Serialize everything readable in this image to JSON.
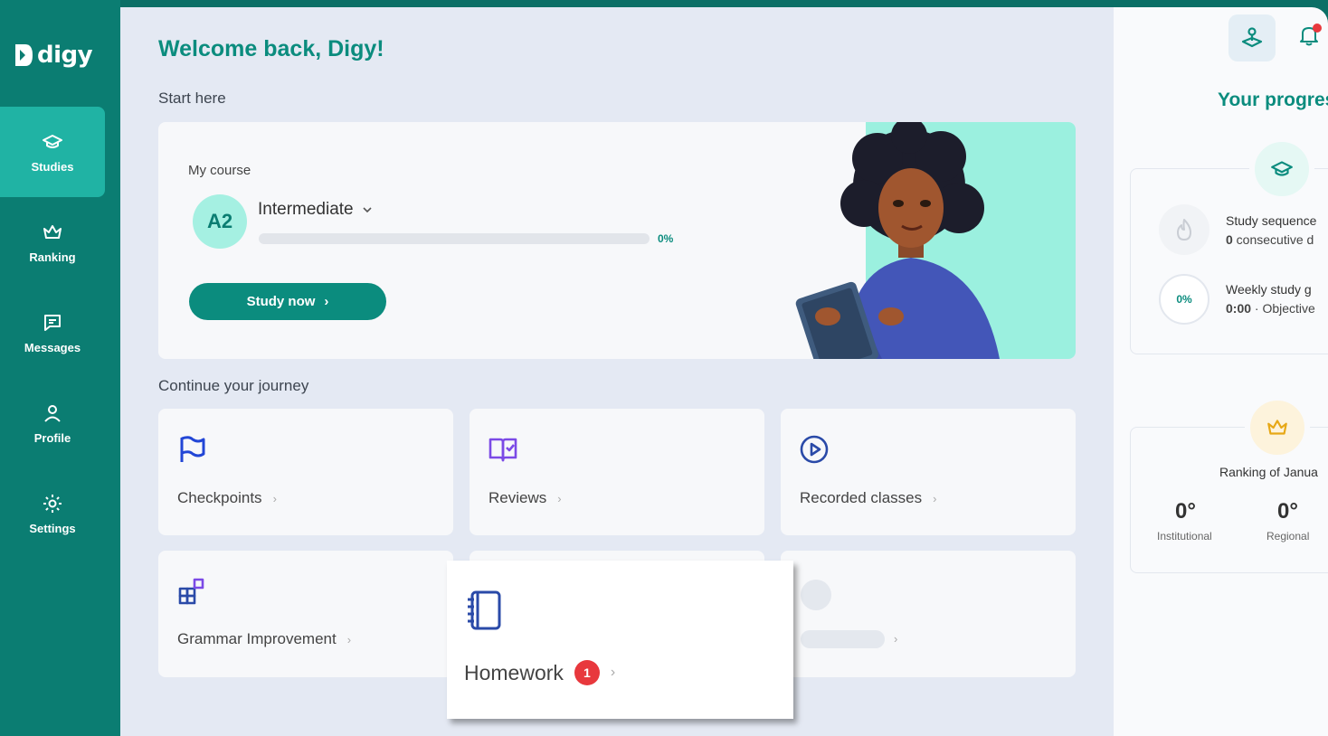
{
  "brand": {
    "name": "digy"
  },
  "sidebar": {
    "items": [
      {
        "label": "Studies",
        "icon": "graduation-cap-icon",
        "active": true
      },
      {
        "label": "Ranking",
        "icon": "crown-icon",
        "active": false
      },
      {
        "label": "Messages",
        "icon": "message-icon",
        "active": false
      },
      {
        "label": "Profile",
        "icon": "user-icon",
        "active": false
      },
      {
        "label": "Settings",
        "icon": "gear-icon",
        "active": false
      }
    ]
  },
  "main": {
    "welcome": "Welcome back, Digy!",
    "start_here": "Start here",
    "course": {
      "label": "My course",
      "level_code": "A2",
      "level_name": "Intermediate",
      "progress_percent": 0,
      "progress_text": "0%",
      "cta": "Study now"
    },
    "continue_label": "Continue your journey",
    "cards": [
      {
        "label": "Checkpoints",
        "icon": "flag-icon"
      },
      {
        "label": "Reviews",
        "icon": "open-book-icon"
      },
      {
        "label": "Recorded classes",
        "icon": "play-circle-icon"
      },
      {
        "label": "Grammar Improvement",
        "icon": "blocks-icon"
      }
    ],
    "homework": {
      "label": "Homework",
      "badge": "1",
      "icon": "notebook-icon"
    }
  },
  "right_panel": {
    "title": "Your progres",
    "study_sequence": {
      "title": "Study sequence",
      "value": "0",
      "suffix": " consecutive d"
    },
    "weekly_goal": {
      "title": "Weekly study g",
      "percent": "0%",
      "time": "0:00",
      "suffix": " · Objective"
    },
    "ranking": {
      "title": "Ranking of Janua",
      "institutional": {
        "value": "0°",
        "label": "Institutional"
      },
      "regional": {
        "value": "0°",
        "label": "Regional"
      }
    }
  },
  "colors": {
    "sidebar": "#0b7d72",
    "active": "#20b3a4",
    "accent": "#0b8c7e",
    "badge": "#e8383d",
    "background": "#e4e9f3"
  }
}
